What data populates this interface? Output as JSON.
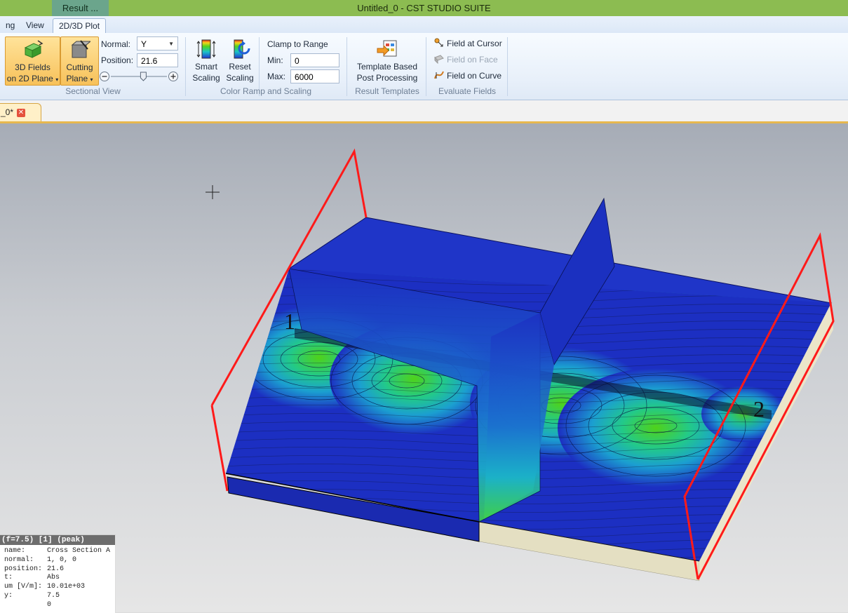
{
  "window": {
    "title": "Untitled_0 - CST STUDIO SUITE",
    "context_tab": "Result ..."
  },
  "ribbon_tabs": [
    {
      "label": "ng",
      "active": false
    },
    {
      "label": "View",
      "active": false
    },
    {
      "label": "2D/3D Plot",
      "active": true
    }
  ],
  "sectional_view": {
    "fields_btn": [
      "3D Fields",
      "on 2D Plane"
    ],
    "cutting_btn": [
      "Cutting",
      "Plane"
    ],
    "normal_label": "Normal:",
    "normal_value": "Y",
    "position_label": "Position:",
    "position_value": "21.6",
    "slider_level": 0.58,
    "group_label": "Sectional View"
  },
  "color_ramp": {
    "smart_btn": [
      "Smart",
      "Scaling"
    ],
    "reset_btn": [
      "Reset",
      "Scaling"
    ],
    "clamp_label": "Clamp to Range",
    "min_label": "Min:",
    "min_value": "0",
    "max_label": "Max:",
    "max_value": "6000",
    "group_label": "Color Ramp and Scaling"
  },
  "result_templates": {
    "template_btn": [
      "Template Based",
      "Post Processing"
    ],
    "group_label": "Result Templates"
  },
  "evaluate_fields": {
    "items": [
      {
        "label": "Field at Cursor",
        "enabled": true,
        "icon": "cursor-probe-icon"
      },
      {
        "label": "Field on Face",
        "enabled": false,
        "icon": "face-icon"
      },
      {
        "label": "Field on Curve",
        "enabled": true,
        "icon": "curve-icon"
      }
    ],
    "group_label": "Evaluate Fields"
  },
  "document_tab": {
    "label": "_0*"
  },
  "viewport": {
    "port_labels": [
      "1",
      "2"
    ],
    "colors": {
      "field_low": "#1c2fc2",
      "field_mid": "#1bb3c9",
      "field_high": "#4fd21a",
      "bounding_box": "#ff1a1a",
      "substrate": "#e9e4c7"
    }
  },
  "info_panel": {
    "header": "(f=7.5) [1] (peak)",
    "rows": [
      {
        "key": " name:",
        "value": "Cross Section A"
      },
      {
        "key": " normal:",
        "value": "1, 0, 0"
      },
      {
        "key": " position:",
        "value": "21.6"
      },
      {
        "key": "t:",
        "value": "Abs"
      },
      {
        "key": "um [V/m]:",
        "value": "10.01e+03"
      },
      {
        "key": "y:",
        "value": "7.5"
      },
      {
        "key": "",
        "value": "0"
      }
    ]
  }
}
